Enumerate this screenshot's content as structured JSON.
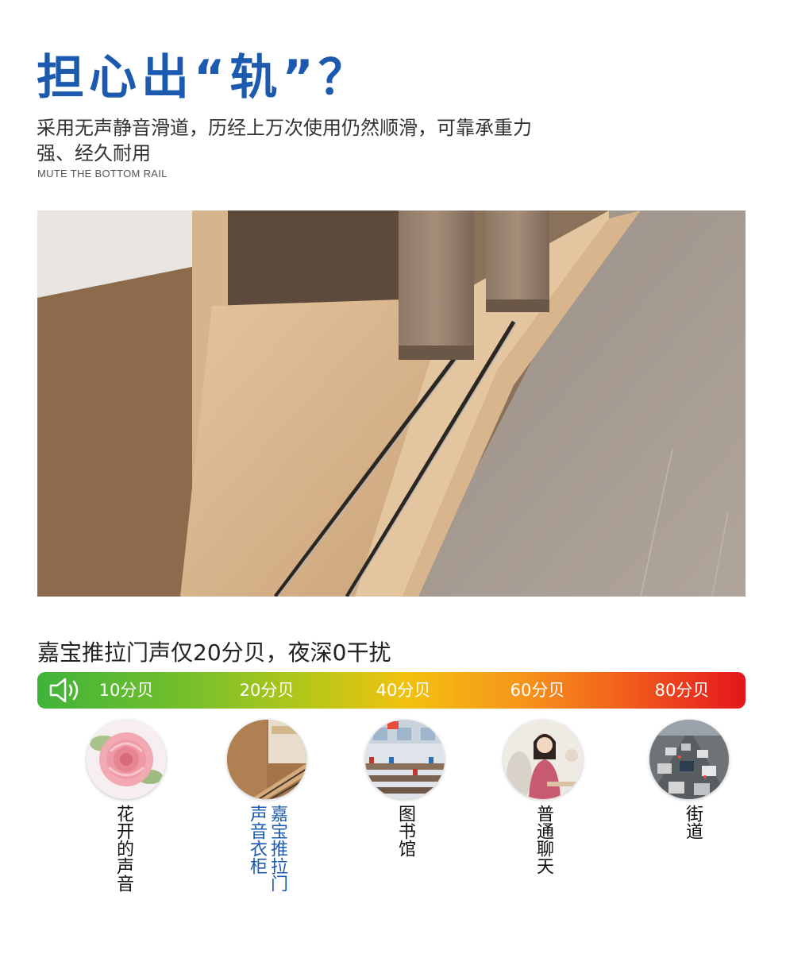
{
  "headline": "担心出“轨”？",
  "description": "采用无声静音滑道，历经上万次使用仍然顺滑，可靠承重力强、经久耐用",
  "description_en": "MUTE THE BOTTOM RAIL",
  "noise_title": "嘉宝推拉门声仅20分贝，夜深0干扰",
  "scale": {
    "icon": "speaker-icon",
    "levels": [
      "10分贝",
      "20分贝",
      "40分贝",
      "60分贝",
      "80分贝"
    ]
  },
  "examples": [
    {
      "label": "花开的声音",
      "image": "rose-photo"
    },
    {
      "label": "嘉宝推拉门声音衣柜",
      "image": "wardrobe-door-photo",
      "highlight_color": "#1c5ab0"
    },
    {
      "label": "图书馆",
      "image": "library-photo"
    },
    {
      "label": "普通聊天",
      "image": "cafe-chat-photo"
    },
    {
      "label": "街道",
      "image": "street-traffic-photo"
    }
  ],
  "colors": {
    "headline": "#1c5ab0",
    "scale_start": "#3fb33a",
    "scale_end": "#e3161d"
  }
}
